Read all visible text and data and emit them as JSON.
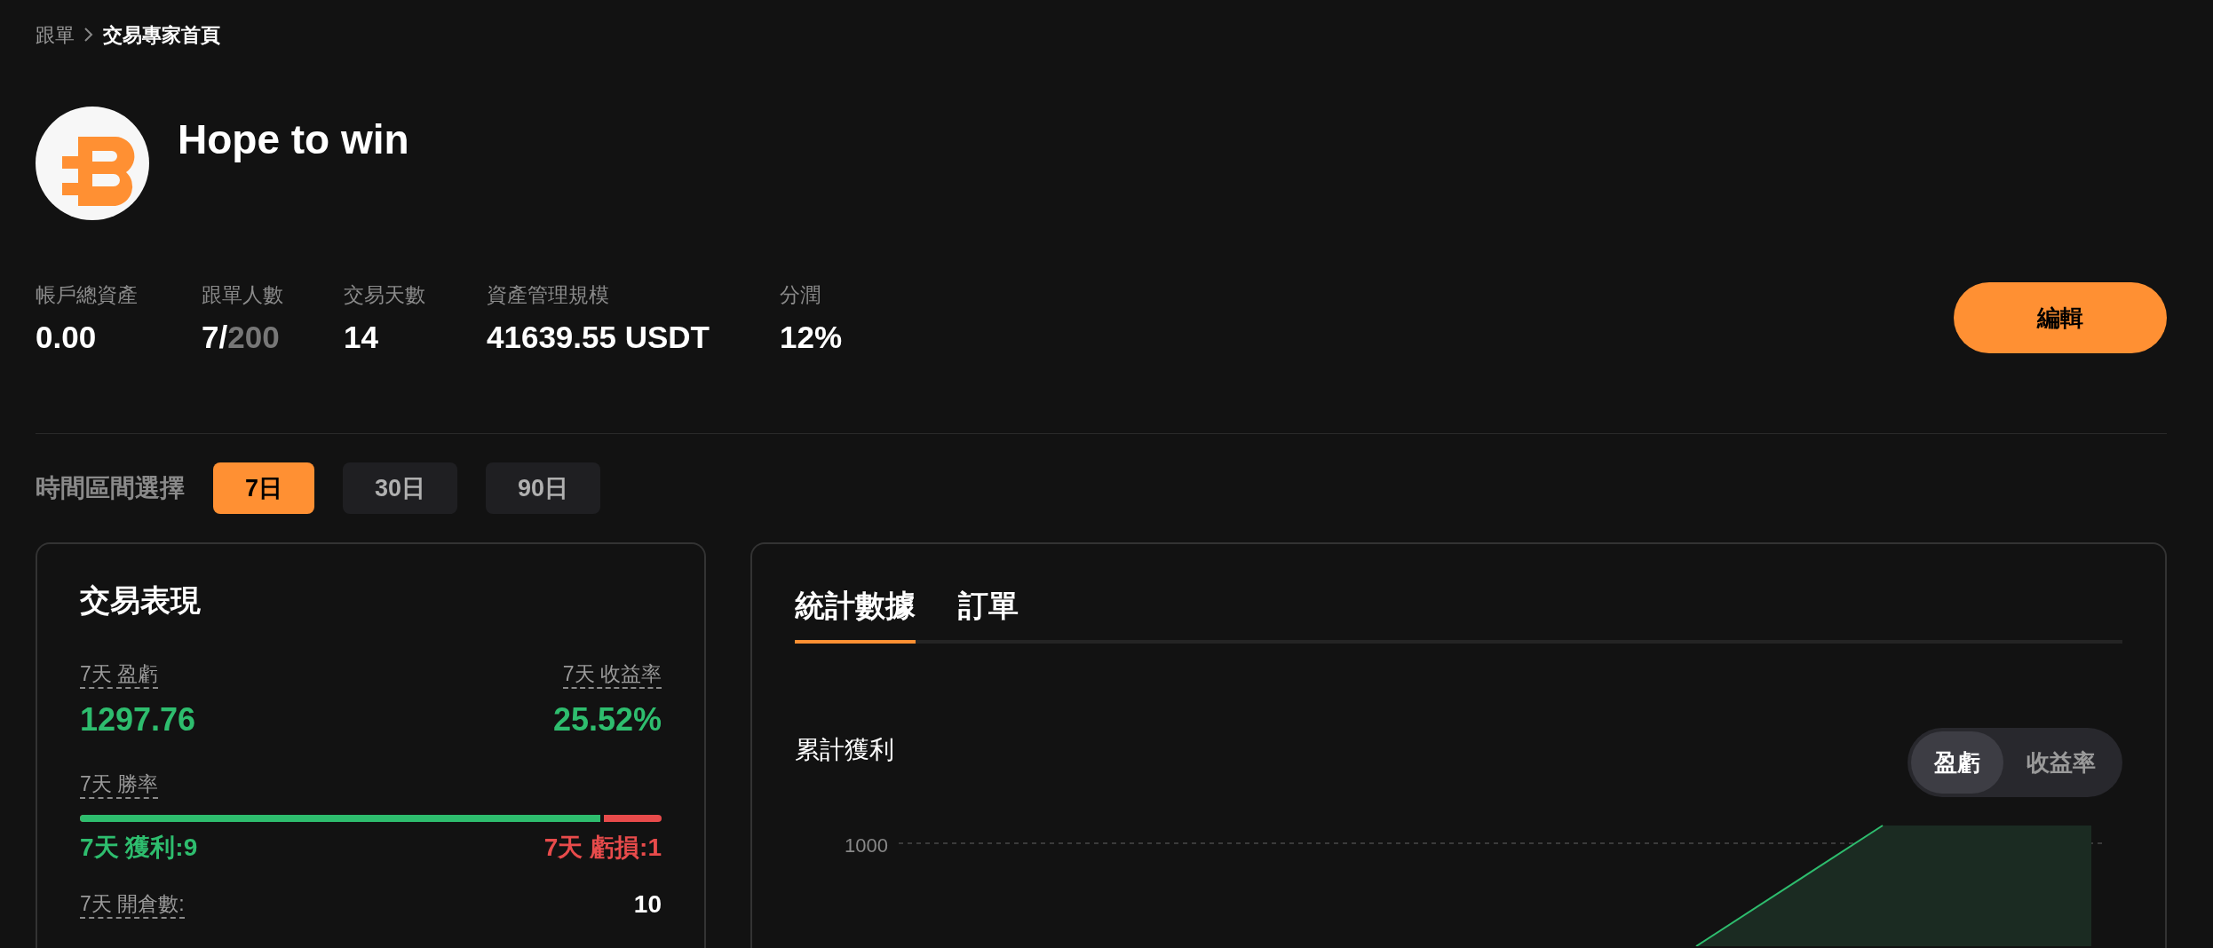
{
  "breadcrumb": [
    {
      "label": "跟單",
      "current": false
    },
    {
      "label": "交易專家首頁",
      "current": true
    }
  ],
  "profile": {
    "name": "Hope to win"
  },
  "stats": [
    {
      "label": "帳戶總資產",
      "value": "0.00"
    },
    {
      "label": "跟單人數",
      "value": "7/",
      "muted": "200"
    },
    {
      "label": "交易天數",
      "value": "14"
    },
    {
      "label": "資產管理規模",
      "value": "41639.55 USDT"
    },
    {
      "label": "分潤",
      "value": "12%"
    }
  ],
  "edit_button": "編輯",
  "period": {
    "label": "時間區間選擇",
    "options": [
      {
        "label": "7日",
        "selected": true
      },
      {
        "label": "30日",
        "selected": false
      },
      {
        "label": "90日",
        "selected": false
      }
    ]
  },
  "performance": {
    "title": "交易表現",
    "pnl": {
      "label": "7天 盈虧",
      "value": "1297.76"
    },
    "roi": {
      "label": "7天 收益率",
      "value": "25.52%"
    },
    "win_rate": {
      "label": "7天 勝率",
      "level": 0.9,
      "wins": "7天 獲利:9",
      "losses": "7天 虧損:1"
    },
    "open_count": {
      "label": "7天 開倉數:",
      "value": "10"
    }
  },
  "stats_panel": {
    "tabs": [
      {
        "label": "統計數據",
        "selected": true
      },
      {
        "label": "訂單",
        "selected": false
      }
    ],
    "chart_title": "累計獲利",
    "toggle": [
      {
        "label": "盈虧",
        "selected": true
      },
      {
        "label": "收益率",
        "selected": false
      }
    ],
    "y_tick": "1000"
  }
}
